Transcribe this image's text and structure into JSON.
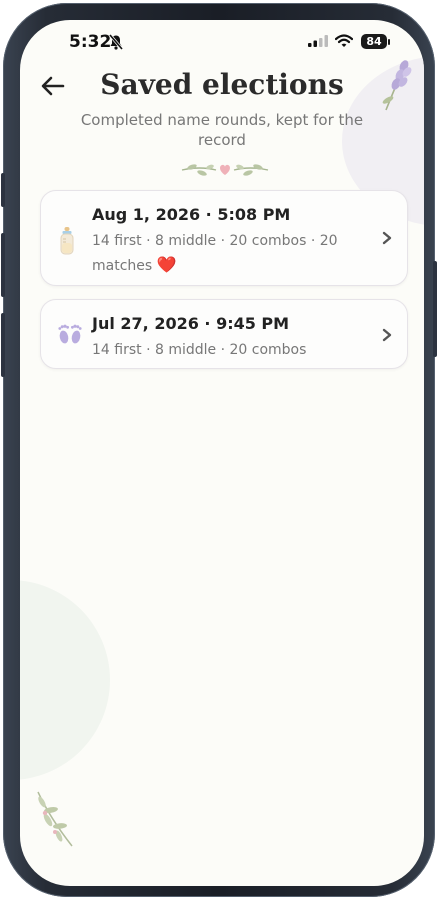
{
  "status_bar": {
    "time": "5:32",
    "battery": "84"
  },
  "header": {
    "title": "Saved elections",
    "subtitle": "Completed name rounds, kept for the record"
  },
  "elections": [
    {
      "icon": "baby-bottle-icon",
      "date": "Aug 1, 2026 · 5:08 PM",
      "meta": "14 first · 8 middle · 20 combos · 20 matches",
      "heart": "❤️"
    },
    {
      "icon": "baby-footprints-icon",
      "date": "Jul 27, 2026 · 9:45 PM",
      "meta": "14 first · 8 middle · 20 combos"
    }
  ],
  "colors": {
    "background": "#fcfcf8",
    "card_border": "#e6e3e8",
    "title": "#2b2b2b",
    "muted": "#777777",
    "heart": "#d93a3a"
  }
}
